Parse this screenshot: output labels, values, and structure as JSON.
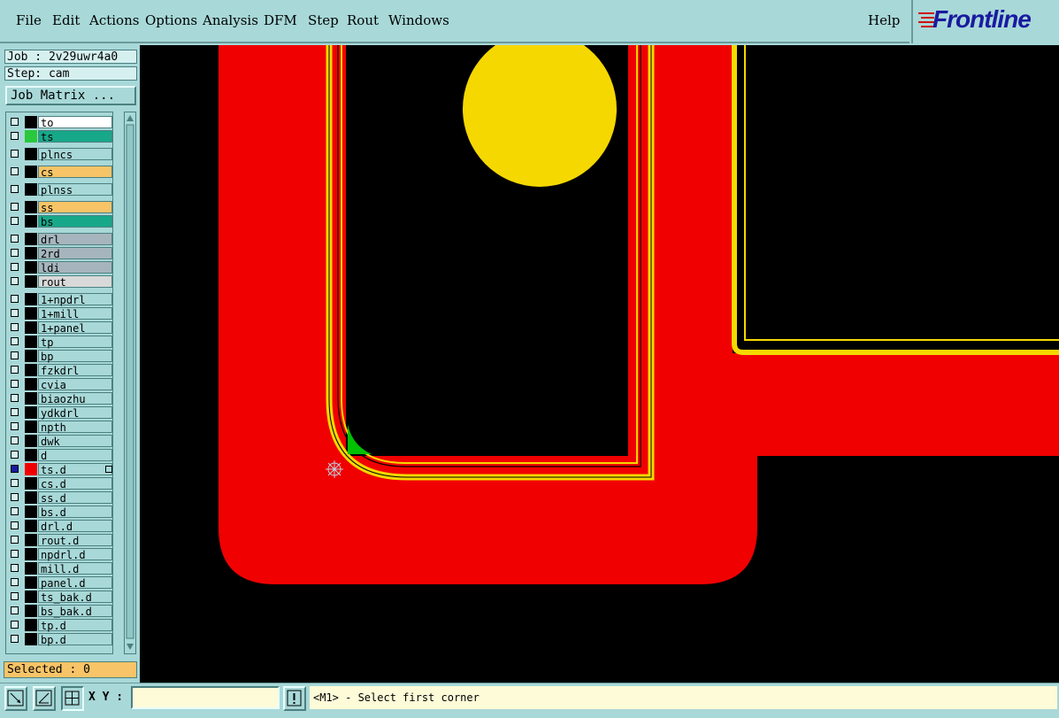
{
  "menu": {
    "file": "File",
    "edit": "Edit",
    "actions": "Actions",
    "options": "Options",
    "analysis": "Analysis",
    "dfm": "DFM",
    "step": "Step",
    "rout": "Rout",
    "windows": "Windows",
    "help": "Help"
  },
  "brand": "Frontline",
  "job_label": "Job : 2v29uwr4a0",
  "step_label": "Step: cam",
  "job_matrix_button": "Job Matrix ...",
  "layers": [
    {
      "name": "to",
      "color": "#ffffff",
      "swatch": "#000000",
      "on": false
    },
    {
      "name": "ts",
      "color": "#17a889",
      "swatch": "#29c93b",
      "on": false
    },
    {
      "name": "plncs",
      "color": "#a8d8d8",
      "swatch": "#000000",
      "on": false
    },
    {
      "name": "cs",
      "color": "#f7c467",
      "swatch": "#000000",
      "on": false
    },
    {
      "name": "plnss",
      "color": "#a8d8d8",
      "swatch": "#000000",
      "on": false
    },
    {
      "name": "ss",
      "color": "#f7c467",
      "swatch": "#000000",
      "on": false
    },
    {
      "name": "bs",
      "color": "#17a889",
      "swatch": "#000000",
      "on": false
    },
    {
      "name": "drl",
      "color": "#a6b5bd",
      "swatch": "#000000",
      "on": false
    },
    {
      "name": "2rd",
      "color": "#a6b5bd",
      "swatch": "#000000",
      "on": false
    },
    {
      "name": "ldi",
      "color": "#a6b5bd",
      "swatch": "#000000",
      "on": false
    },
    {
      "name": "rout",
      "color": "#d9d9d9",
      "swatch": "#000000",
      "on": false
    },
    {
      "name": "1+npdrl",
      "color": "#a8d8d8",
      "swatch": "#000000",
      "on": false
    },
    {
      "name": "1+mill",
      "color": "#a8d8d8",
      "swatch": "#000000",
      "on": false
    },
    {
      "name": "1+panel",
      "color": "#a8d8d8",
      "swatch": "#000000",
      "on": false
    },
    {
      "name": "tp",
      "color": "#a8d8d8",
      "swatch": "#000000",
      "on": false
    },
    {
      "name": "bp",
      "color": "#a8d8d8",
      "swatch": "#000000",
      "on": false
    },
    {
      "name": "fzkdrl",
      "color": "#a8d8d8",
      "swatch": "#000000",
      "on": false
    },
    {
      "name": "cvia",
      "color": "#a8d8d8",
      "swatch": "#000000",
      "on": false
    },
    {
      "name": "biaozhu",
      "color": "#a8d8d8",
      "swatch": "#000000",
      "on": false
    },
    {
      "name": "ydkdrl",
      "color": "#a8d8d8",
      "swatch": "#000000",
      "on": false
    },
    {
      "name": "npth",
      "color": "#a8d8d8",
      "swatch": "#000000",
      "on": false
    },
    {
      "name": "dwk",
      "color": "#a8d8d8",
      "swatch": "#000000",
      "on": false
    },
    {
      "name": "d",
      "color": "#a8d8d8",
      "swatch": "#000000",
      "on": false
    },
    {
      "name": "ts.d",
      "color": "#a8d8d8",
      "swatch": "#f00000",
      "on": true
    },
    {
      "name": "cs.d",
      "color": "#a8d8d8",
      "swatch": "#000000",
      "on": false
    },
    {
      "name": "ss.d",
      "color": "#a8d8d8",
      "swatch": "#000000",
      "on": false
    },
    {
      "name": "bs.d",
      "color": "#a8d8d8",
      "swatch": "#000000",
      "on": false
    },
    {
      "name": "drl.d",
      "color": "#a8d8d8",
      "swatch": "#000000",
      "on": false
    },
    {
      "name": "rout.d",
      "color": "#a8d8d8",
      "swatch": "#000000",
      "on": false
    },
    {
      "name": "npdrl.d",
      "color": "#a8d8d8",
      "swatch": "#000000",
      "on": false
    },
    {
      "name": "mill.d",
      "color": "#a8d8d8",
      "swatch": "#000000",
      "on": false
    },
    {
      "name": "panel.d",
      "color": "#a8d8d8",
      "swatch": "#000000",
      "on": false
    },
    {
      "name": "ts_bak.d",
      "color": "#a8d8d8",
      "swatch": "#000000",
      "on": false
    },
    {
      "name": "bs_bak.d",
      "color": "#a8d8d8",
      "swatch": "#000000",
      "on": false
    },
    {
      "name": "tp.d",
      "color": "#a8d8d8",
      "swatch": "#000000",
      "on": false
    },
    {
      "name": "bp.d",
      "color": "#a8d8d8",
      "swatch": "#000000",
      "on": false
    }
  ],
  "selected_label": "Selected : 0",
  "xy_label": "X Y :",
  "xy_value": "",
  "status_message": "<M1> - Select first corner",
  "colors": {
    "trace": "#f00000",
    "pad": "#f5d800",
    "highlight": "#00c000",
    "background": "#000000",
    "panel": "#a8d8d8"
  }
}
